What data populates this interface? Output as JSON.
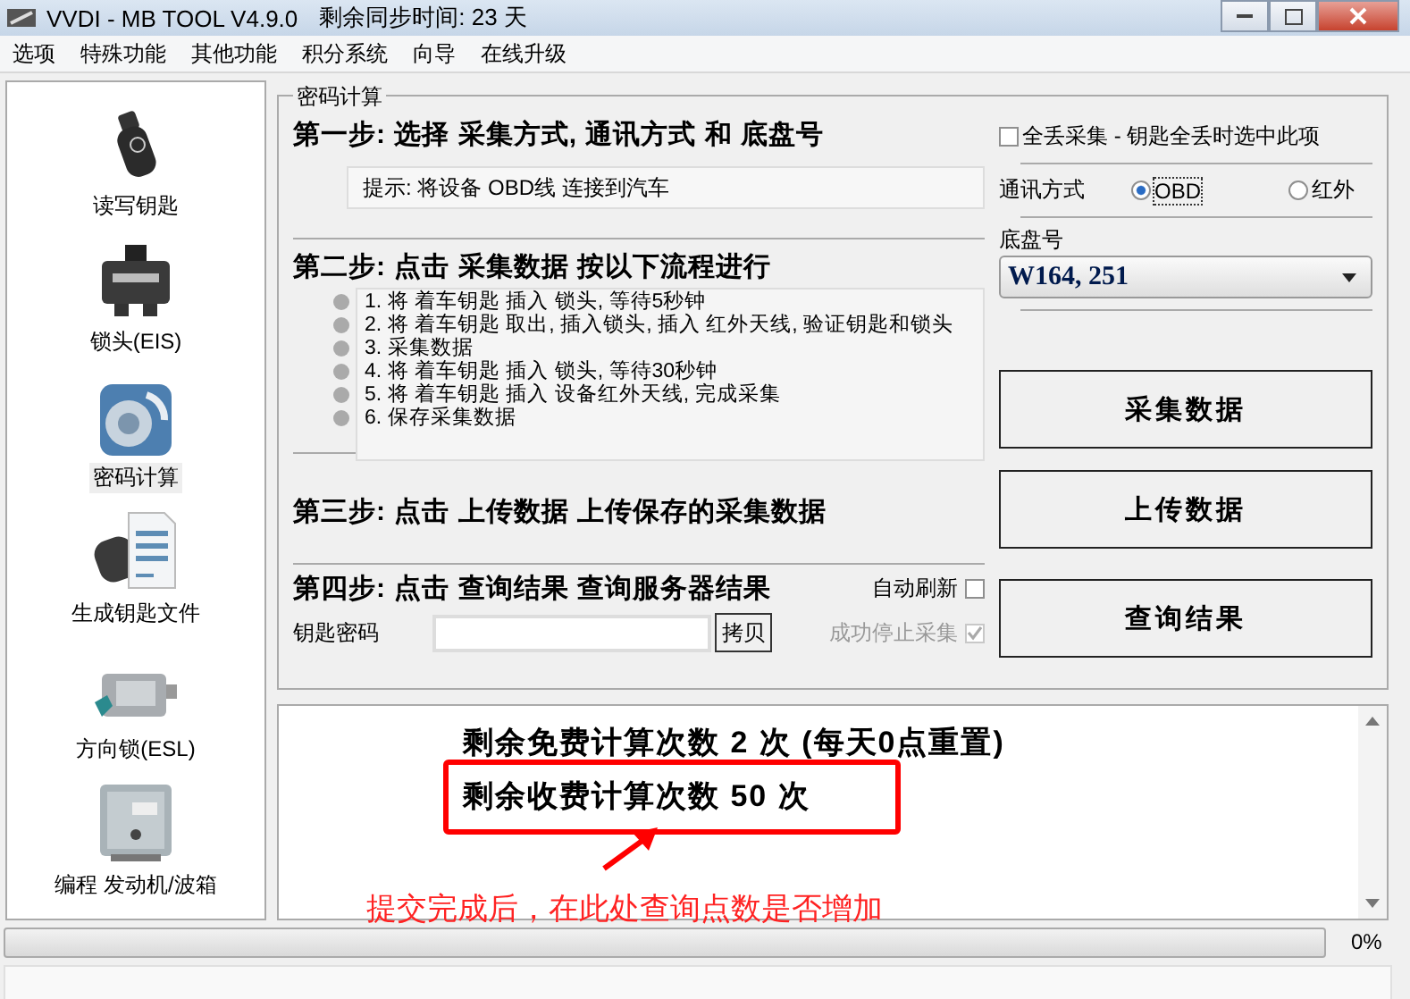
{
  "window": {
    "title": "VVDI - MB TOOL V4.9.0",
    "sync_info": "剩余同步时间: 23 天"
  },
  "menu": [
    "选项",
    "特殊功能",
    "其他功能",
    "积分系统",
    "向导",
    "在线升级"
  ],
  "sidebar": {
    "items": [
      {
        "label": "读写钥匙",
        "kind": "key",
        "selected": false
      },
      {
        "label": "锁头(EIS)",
        "kind": "eis",
        "selected": false
      },
      {
        "label": "密码计算",
        "kind": "dial",
        "selected": true
      },
      {
        "label": "生成钥匙文件",
        "kind": "keyfile",
        "selected": false
      },
      {
        "label": "方向锁(ESL)",
        "kind": "esl",
        "selected": false
      },
      {
        "label": "编程 发动机/波箱",
        "kind": "ecu",
        "selected": false
      }
    ]
  },
  "group_title": "密码计算",
  "step1": {
    "title": "第一步: 选择 采集方式, 通讯方式 和 底盘号",
    "hint": "提示: 将设备 OBD线 连接到汽车"
  },
  "all_lost": {
    "label": "全丢采集 - 钥匙全丢时选中此项",
    "checked": false
  },
  "comm": {
    "label": "通讯方式",
    "options": [
      {
        "label": "OBD",
        "selected": true
      },
      {
        "label": "红外",
        "selected": false
      }
    ]
  },
  "chassis": {
    "label": "底盘号",
    "value": "W164, 251"
  },
  "step2": {
    "title": "第二步: 点击 采集数据 按以下流程进行",
    "steps": [
      "1. 将 着车钥匙 插入 锁头, 等待5秒钟",
      "2. 将 着车钥匙 取出, 插入锁头, 插入 红外天线, 验证钥匙和锁头",
      "3. 采集数据",
      "4. 将 着车钥匙 插入 锁头, 等待30秒钟",
      "5. 将 着车钥匙 插入 设备红外天线, 完成采集",
      "6. 保存采集数据"
    ]
  },
  "collect_button": "采集数据",
  "step3": {
    "title": "第三步: 点击 上传数据 上传保存的采集数据"
  },
  "upload_button": "上传数据",
  "step4": {
    "title": "第四步: 点击 查询结果 查询服务器结果",
    "auto_refresh": {
      "label": "自动刷新",
      "checked": false
    },
    "stop_on_success": {
      "label": "成功停止采集",
      "checked": true,
      "disabled": true
    },
    "key_password_label": "钥匙密码",
    "copy_button": "拷贝"
  },
  "query_button": "查询结果",
  "output": {
    "lines": [
      "剩余免费计算次数 2 次 (每天0点重置)",
      "剩余收费计算次数 50 次"
    ]
  },
  "progress": {
    "level": 0,
    "reading": "0%"
  },
  "annotation": {
    "text": "提交完成后，在此处查询点数是否增加"
  }
}
